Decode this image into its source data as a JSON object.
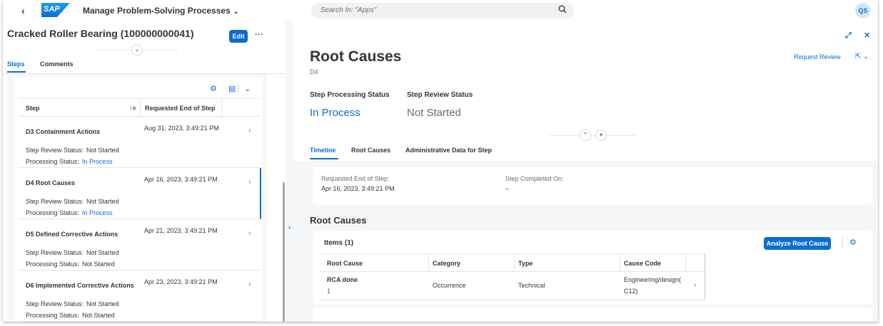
{
  "shell": {
    "back": "‹",
    "logo": "SAP",
    "app_title": "Manage Problem-Solving Processes",
    "app_title_chevron": "⌄",
    "search_placeholder": "Search In: \"Apps\"",
    "avatar": "QS"
  },
  "left": {
    "object_title": "Cracked Roller Bearing (100000000041)",
    "edit_label": "Edit",
    "more_label": "···",
    "tabs": [
      "Steps",
      "Comments"
    ],
    "table": {
      "columns": [
        "Step",
        "Requested End of Step"
      ],
      "rows": [
        {
          "name": "D3 Containment Actions",
          "date": "Aug 31, 2023, 3:49:21 PM",
          "review_label": "Step Review Status:",
          "review_value": "Not Started",
          "proc_label": "Processing Status:",
          "proc_value": "In Process"
        },
        {
          "name": "D4 Root Causes",
          "date": "Apr 16, 2023, 3:49:21 PM",
          "review_label": "Step Review Status:",
          "review_value": "Not Started",
          "proc_label": "Processing Status:",
          "proc_value": "In Process"
        },
        {
          "name": "D5 Defined Corrective Actions",
          "date": "Apr 21, 2023, 3:49:21 PM",
          "review_label": "Step Review Status:",
          "review_value": "Not Started",
          "proc_label": "Processing Status:",
          "proc_value": "Not Started"
        },
        {
          "name": "D6 Implemented Corrective Actions",
          "date": "Apr 23, 2023, 3:49:21 PM",
          "review_label": "Step Review Status:",
          "review_value": "Not Started",
          "proc_label": "Processing Status:",
          "proc_value": "Not Started"
        }
      ]
    }
  },
  "right": {
    "title": "Root Causes",
    "subtitle": "D4",
    "request_review": "Request Review",
    "step_processing_label": "Step Processing Status",
    "step_processing_value": "In Process",
    "step_review_label": "Step Review Status",
    "step_review_value": "Not Started",
    "tabs": [
      "Timeline",
      "Root Causes",
      "Administrative Data for Step"
    ],
    "timeline": {
      "requested_label": "Requested End of Step:",
      "requested_value": "Apr 16, 2023, 3:49:21 PM",
      "completed_label": "Step Completed On:",
      "completed_value": "–"
    },
    "section_title": "Root Causes",
    "items": {
      "title": "Items (1)",
      "analyze_label": "Analyze Root Cause",
      "columns": [
        "Root Cause",
        "Category",
        "Type",
        "Cause Code"
      ],
      "row": {
        "root_cause": "RCA done",
        "root_cause_id": "1",
        "category": "Occurrence",
        "type": "Technical",
        "cause_code_line1": "Engineering/design(",
        "cause_code_line2": "C12)"
      }
    }
  },
  "colors": {
    "accent": "#0a6ed1",
    "text": "#32363a",
    "muted": "#6a6d70",
    "background": "#f5f6f7"
  }
}
